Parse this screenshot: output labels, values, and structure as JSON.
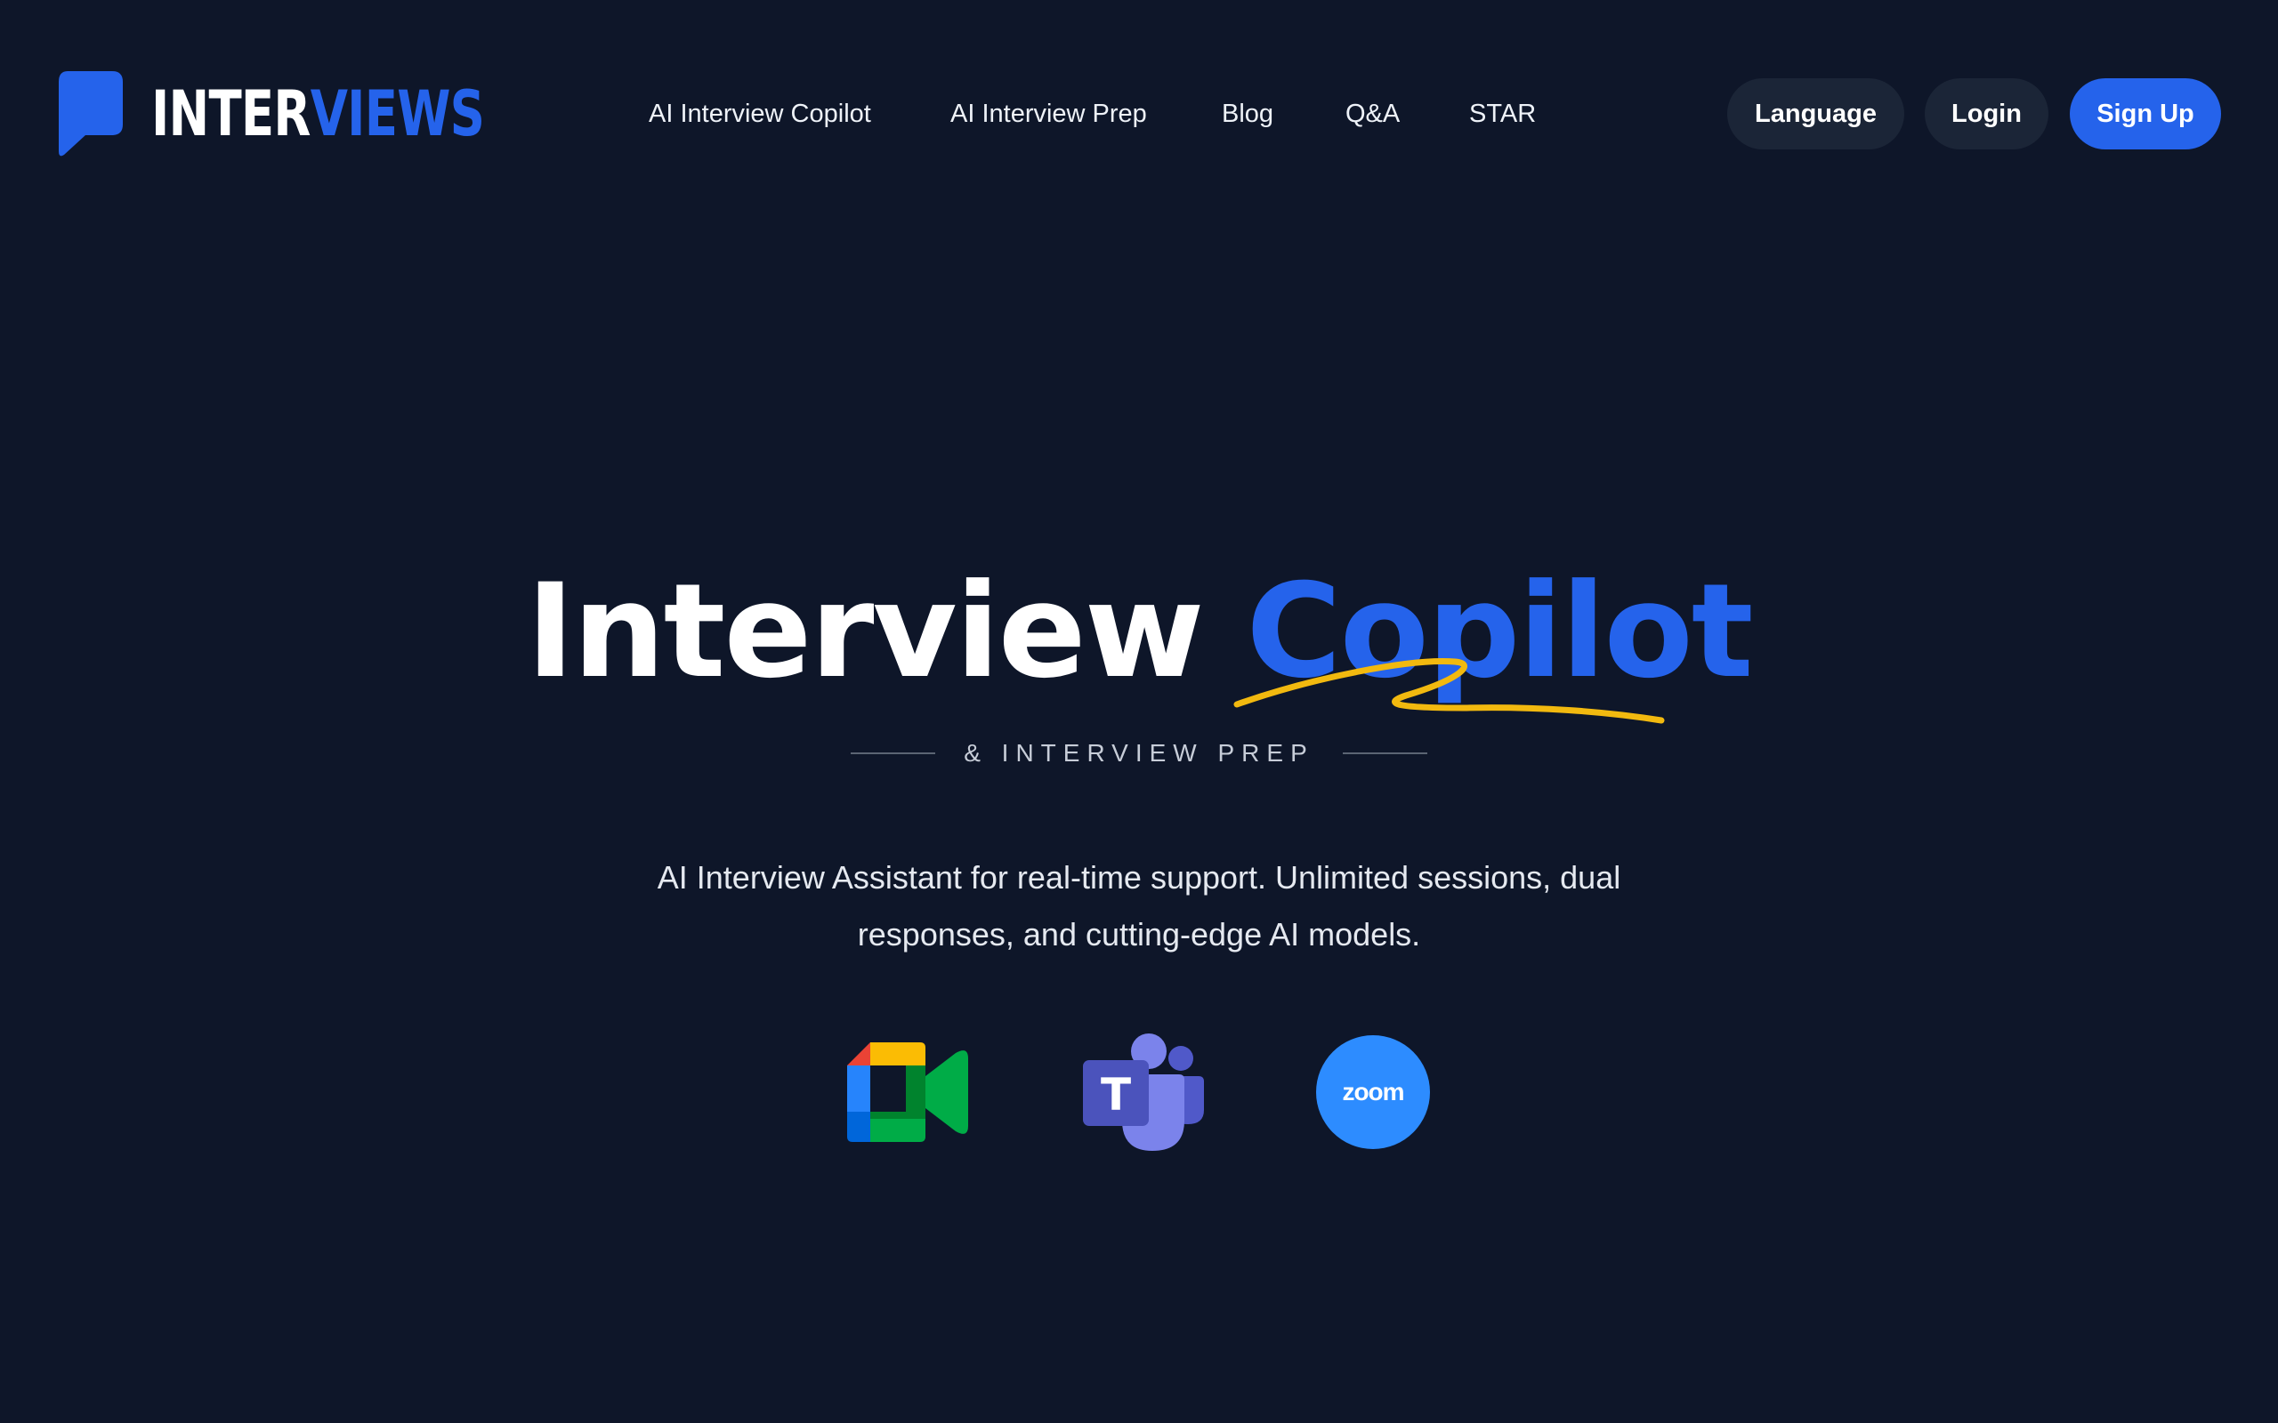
{
  "brand": {
    "name_part1": "INTER",
    "name_part2": "VIEWS",
    "logo_icon": "speech-bubble-icon",
    "accent_color": "#2563eb"
  },
  "nav": {
    "items": [
      {
        "label": "AI Interview Copilot"
      },
      {
        "label": "AI Interview Prep"
      },
      {
        "label": "Blog"
      },
      {
        "label": "Q&A"
      },
      {
        "label": "STAR"
      }
    ]
  },
  "header_actions": {
    "language_label": "Language",
    "login_label": "Login",
    "signup_label": "Sign Up"
  },
  "hero": {
    "title_part1": "Interview",
    "title_part2": "Copilot",
    "subtitle": "& INTERVIEW PREP",
    "description": "AI Interview Assistant for real-time support. Unlimited sessions, dual responses, and cutting-edge AI models.",
    "underline_color": "#f2b90f"
  },
  "platforms": [
    {
      "name": "Google Meet",
      "icon": "google-meet-icon"
    },
    {
      "name": "Microsoft Teams",
      "icon": "microsoft-teams-icon"
    },
    {
      "name": "Zoom",
      "icon": "zoom-icon",
      "label": "zoom"
    }
  ],
  "colors": {
    "background": "#0e1629",
    "button_dark": "#1b2537"
  }
}
